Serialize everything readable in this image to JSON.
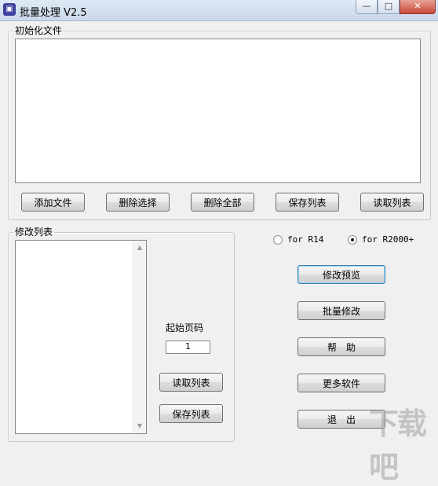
{
  "window": {
    "title": "批量处理 V2.5",
    "icon": "app-icon",
    "minimize_symbol": "—",
    "maximize_symbol": "□",
    "close_symbol": "✕"
  },
  "init_group": {
    "legend": "初始化文件",
    "buttons": {
      "add_file": "添加文件",
      "delete_selected": "删除选择",
      "delete_all": "删除全部",
      "save_list": "保存列表",
      "read_list": "读取列表"
    }
  },
  "modify_group": {
    "legend": "修改列表",
    "start_page_label": "起始页码",
    "start_page_value": "1",
    "read_list": "读取列表",
    "save_list": "保存列表"
  },
  "radios": {
    "r14": {
      "label": "for R14",
      "checked": false
    },
    "r2000": {
      "label": "for R2000+",
      "checked": true
    }
  },
  "actions": {
    "preview": "修改预览",
    "batch_modify": "批量修改",
    "help": "帮　助",
    "more_software": "更多软件",
    "exit": "退　出"
  },
  "watermark": "下载吧"
}
